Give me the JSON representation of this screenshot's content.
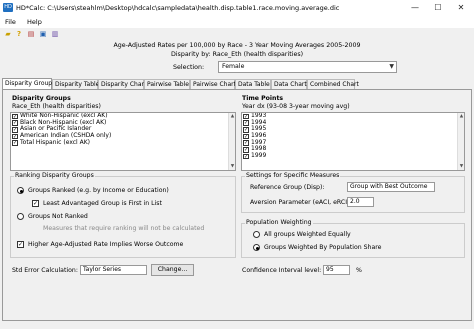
{
  "window": {
    "title": "HD*Calc: C:\\Users\\steahlm\\Desktop\\hdcalc\\sampledata\\health.disp.table1.race.moving.average.dic",
    "minimize": "—",
    "maximize": "☐",
    "close": "✕"
  },
  "menu": {
    "file": "File",
    "help": "Help"
  },
  "toolbar": [
    "folder-open-icon",
    "help-icon",
    "print-icon",
    "export-icon",
    "chart-icon"
  ],
  "header": {
    "line1": "Age-Adjusted Rates per 100,000 by Race - 3 Year Moving Averages 2005-2009",
    "line2": "Disparity by: Race_Eth (health disparities)"
  },
  "selection": {
    "label": "Selection:",
    "value": "Female"
  },
  "tabs": [
    "Disparity Groups",
    "Disparity Table",
    "Disparity Chart",
    "Pairwise Table",
    "Pairwise Chart",
    "Data Table",
    "Data Chart",
    "Combined Chart"
  ],
  "groups": {
    "title": "Disparity Groups",
    "subtitle": "Race_Eth (health disparities)",
    "items": [
      "White Non-Hispanic (excl AK)",
      "Black Non-Hispanic (excl AK)",
      "Asian or Pacific Islander",
      "American Indian (CSHDA only)",
      "Total Hispanic (excl AK)"
    ]
  },
  "timepoints": {
    "title": "Time Points",
    "subtitle": "Year dx (93-08 3-year moving avg)",
    "items": [
      "1993",
      "1994",
      "1995",
      "1996",
      "1997",
      "1998",
      "1999"
    ]
  },
  "ranking": {
    "title": "Ranking Disparity Groups",
    "ranked": "Groups Ranked (e.g. by Income or Education)",
    "least_adv": "Least Advantaged Group is First in List",
    "not_ranked": "Groups Not Ranked",
    "note": "Measures that require ranking will not be calculated",
    "higher": "Higher Age-Adjusted Rate Implies Worse Outcome"
  },
  "settings": {
    "title": "Settings for Specific Measures",
    "ref_label": "Reference Group (Disp):",
    "ref_value": "Group with Best Outcome",
    "aversion_label": "Aversion Parameter (eACI, eRCI):",
    "aversion_value": "2.0"
  },
  "weighting": {
    "title": "Population Weighting",
    "equal": "All groups Weighted Equally",
    "pop": "Groups Weighted By Population Share"
  },
  "stderr": {
    "label": "Std Error Calculation:",
    "value": "Taylor Series",
    "button": "Change..."
  },
  "ci": {
    "label": "Confidence Interval level:",
    "value": "95",
    "unit": "%"
  }
}
